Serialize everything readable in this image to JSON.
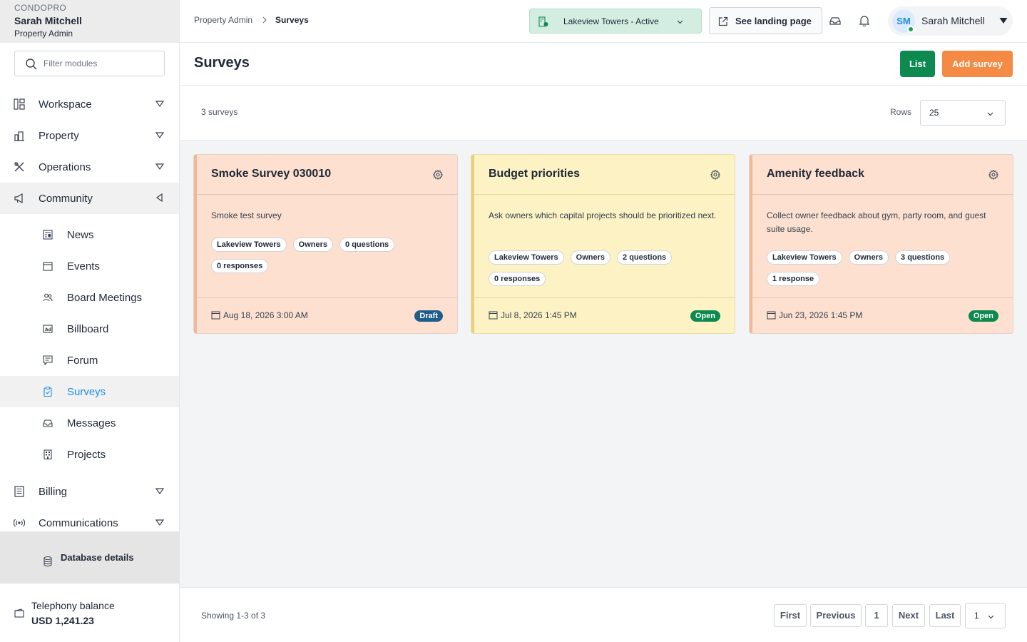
{
  "sidebar": {
    "brand": "CONDOPRO",
    "user_name": "Sarah Mitchell",
    "user_role": "Property Admin",
    "filter_placeholder": "Filter modules",
    "groups": [
      {
        "label": "Workspace",
        "icon": "layout-icon"
      },
      {
        "label": "Property",
        "icon": "building-chart-icon"
      },
      {
        "label": "Operations",
        "icon": "tools-icon"
      },
      {
        "label": "Community",
        "icon": "megaphone-icon"
      }
    ],
    "community_items": [
      {
        "label": "News",
        "icon": "newspaper-icon"
      },
      {
        "label": "Events",
        "icon": "calendar-icon"
      },
      {
        "label": "Board Meetings",
        "icon": "people-icon"
      },
      {
        "label": "Billboard",
        "icon": "ad-icon"
      },
      {
        "label": "Forum",
        "icon": "chat-icon"
      },
      {
        "label": "Surveys",
        "icon": "clipboard-icon"
      },
      {
        "label": "Messages",
        "icon": "inbox-icon"
      },
      {
        "label": "Projects",
        "icon": "building-icon"
      }
    ],
    "lower_groups": [
      {
        "label": "Billing",
        "icon": "receipt-icon"
      },
      {
        "label": "Communications",
        "icon": "broadcast-icon"
      }
    ],
    "database_details": "Database details",
    "telephony_label": "Telephony balance",
    "telephony_value": "USD 1,241.23"
  },
  "topbar": {
    "breadcrumb_root": "Property Admin",
    "breadcrumb_current": "Surveys",
    "property_selector": "Lakeview Towers - Active",
    "landing_button": "See landing page",
    "user_initials": "SM",
    "user_name": "Sarah Mitchell"
  },
  "page": {
    "title": "Surveys",
    "list_button": "List",
    "add_button": "Add survey",
    "count_text": "3 surveys",
    "rows_label": "Rows",
    "rows_value": "25"
  },
  "colors": {
    "green": "#0c8a4f",
    "orange": "#f58a45",
    "draft_badge": "#1f5d8a",
    "open_badge": "#0c8a4f",
    "card_peach": "#fde0cf",
    "card_yellow": "#fdf2c4"
  },
  "surveys": [
    {
      "title": "Smoke Survey 030010",
      "description": "Smoke test survey",
      "tags": [
        "Lakeview Towers",
        "Owners",
        "0 questions",
        "0 responses"
      ],
      "date": "Aug 18, 2026 3:00 AM",
      "status": "Draft"
    },
    {
      "title": "Budget priorities",
      "description": "Ask owners which capital projects should be prioritized next.",
      "tags": [
        "Lakeview Towers",
        "Owners",
        "2 questions",
        "0 responses"
      ],
      "date": "Jul 8, 2026 1:45 PM",
      "status": "Open"
    },
    {
      "title": "Amenity feedback",
      "description": "Collect owner feedback about gym, party room, and guest suite usage.",
      "tags": [
        "Lakeview Towers",
        "Owners",
        "3 questions",
        "1 response"
      ],
      "date": "Jun 23, 2026 1:45 PM",
      "status": "Open"
    }
  ],
  "footer": {
    "showing": "Showing 1-3 of 3",
    "first": "First",
    "previous": "Previous",
    "page": "1",
    "next": "Next",
    "last": "Last",
    "page_select": "1"
  }
}
